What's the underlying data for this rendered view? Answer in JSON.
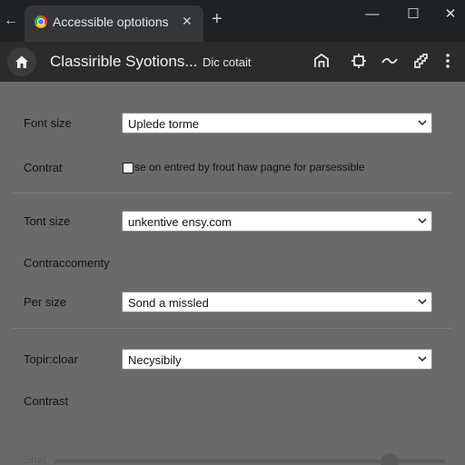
{
  "browser": {
    "tab_title": "Accessible optotions",
    "back_glyph": "←",
    "close_glyph": "✕",
    "new_tab_glyph": "+",
    "window": {
      "minimize": "—",
      "maximize": "☐",
      "close": "✕"
    }
  },
  "header": {
    "title": "Classirible Syotions...",
    "subtitle": "Dic cotait",
    "icons": [
      "home-icon",
      "castle-icon",
      "gear-icon",
      "trend-icon",
      "extension-icon",
      "more-vert-icon"
    ]
  },
  "settings": [
    {
      "label": "Font size",
      "value": "Uplede torme"
    },
    {
      "label": "Contrat",
      "checkbox_text": "se on entred by frout haw pagne for parsessible",
      "checked": false
    },
    {
      "label": "Tont size",
      "value": "unkentive ensy.com"
    },
    {
      "label": "Contraccomenty"
    },
    {
      "label": "Per size",
      "value": "Sond a missled"
    },
    {
      "label": "Topir:cloar",
      "value": "Necysibily"
    },
    {
      "label": "Contrast"
    },
    {
      "label": "Shet"
    }
  ],
  "colors": {
    "tabbar": "#202124",
    "appbar": "#2b2b2b",
    "content": "#6a6a6a"
  }
}
